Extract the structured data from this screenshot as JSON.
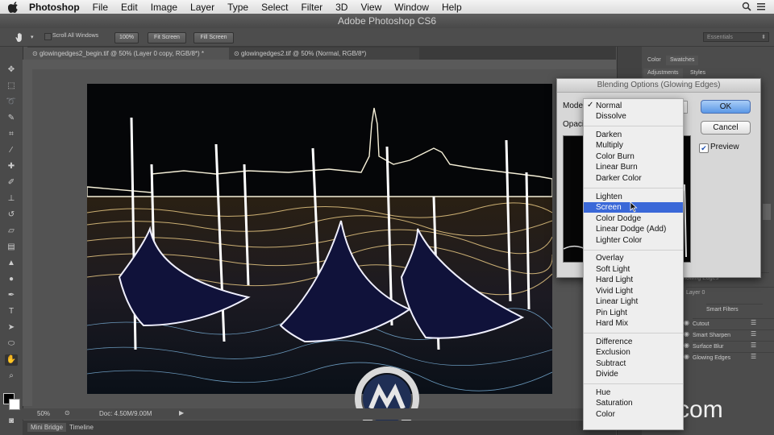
{
  "menubar": {
    "app": "Photoshop",
    "items": [
      "File",
      "Edit",
      "Image",
      "Layer",
      "Type",
      "Select",
      "Filter",
      "3D",
      "View",
      "Window",
      "Help"
    ]
  },
  "window_title": "Adobe Photoshop CS6",
  "options": {
    "scroll_all": "Scroll All Windows",
    "zoom_100": "100%",
    "fit_screen": "Fit Screen",
    "fill_screen": "Fill Screen",
    "workspace": "Essentials"
  },
  "tabs": [
    {
      "label": "glowingedges2_begin.tif @ 50% (Layer 0 copy, RGB/8*) *"
    },
    {
      "label": "glowingedges2.tif @ 50% (Normal, RGB/8*)"
    }
  ],
  "status": {
    "zoom": "50%",
    "doc": "Doc: 4.50M/9.00M"
  },
  "bottom_tabs": [
    "Mini Bridge",
    "Timeline"
  ],
  "panel": {
    "tabs1": [
      "Color",
      "Swatches"
    ],
    "tabs2": [
      "Adjustments",
      "Styles"
    ],
    "layers": {
      "glowing_edges_top": "Glowing Edges",
      "layer0": "Layer 0",
      "smart_filters": "Smart Filters",
      "filters": [
        "Cutout",
        "Smart Sharpen",
        "Surface Blur",
        "Glowing Edges"
      ]
    }
  },
  "dialog": {
    "title": "Blending Options (Glowing Edges)",
    "mode_label": "Mode",
    "opacity_label": "Opaci",
    "ok": "OK",
    "cancel": "Cancel",
    "preview": "Preview",
    "preview_checked": true
  },
  "blend_modes": {
    "selected": "Screen",
    "groups": [
      [
        "Normal",
        "Dissolve"
      ],
      [
        "Darken",
        "Multiply",
        "Color Burn",
        "Linear Burn",
        "Darker Color"
      ],
      [
        "Lighten",
        "Screen",
        "Color Dodge",
        "Linear Dodge (Add)",
        "Lighter Color"
      ],
      [
        "Overlay",
        "Soft Light",
        "Hard Light",
        "Vivid Light",
        "Linear Light",
        "Pin Light",
        "Hard Mix"
      ],
      [
        "Difference",
        "Exclusion",
        "Subtract",
        "Divide"
      ],
      [
        "Hue",
        "Saturation",
        "Color"
      ]
    ]
  },
  "watermark": "lynda.com",
  "colors": {
    "selection": "#3a68d8",
    "chrome": "#535353"
  }
}
